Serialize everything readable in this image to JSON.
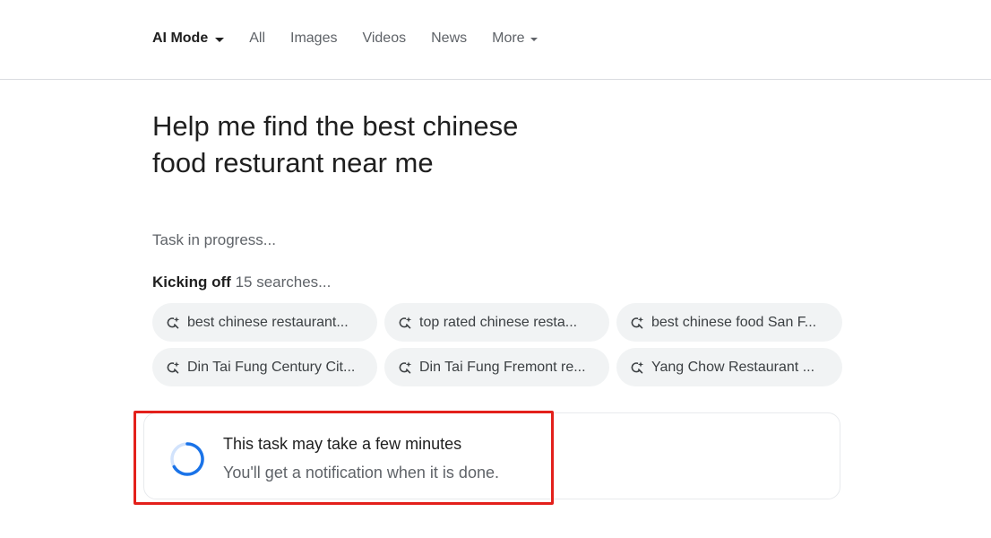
{
  "nav": {
    "tabs": [
      {
        "label": "AI Mode"
      },
      {
        "label": "All"
      },
      {
        "label": "Images"
      },
      {
        "label": "Videos"
      },
      {
        "label": "News"
      },
      {
        "label": "More"
      }
    ]
  },
  "query": {
    "text": "Help me find the best chinese food resturant near me"
  },
  "progress": {
    "status": "Task in progress...",
    "kickoff_strong": "Kicking off",
    "kickoff_rest": " 15 searches..."
  },
  "searches": [
    {
      "label": "best chinese restaurant...",
      "icon": "search-sparkle-icon"
    },
    {
      "label": "top rated chinese resta...",
      "icon": "search-sparkle-icon"
    },
    {
      "label": "best chinese food San F...",
      "icon": "search-sparkle-icon"
    },
    {
      "label": "Din Tai Fung Century Cit...",
      "icon": "search-sparkle-icon"
    },
    {
      "label": "Din Tai Fung Fremont re...",
      "icon": "search-sparkle-icon"
    },
    {
      "label": "Yang Chow Restaurant ...",
      "icon": "search-sparkle-icon"
    }
  ],
  "task_card": {
    "title": "This task may take a few minutes",
    "subtitle": "You'll get a notification when it is done.",
    "icon": "loading-spinner-icon"
  },
  "colors": {
    "spinner": "#1a73e8",
    "highlight": "#e3201b",
    "chip_bg": "#f1f3f4"
  }
}
